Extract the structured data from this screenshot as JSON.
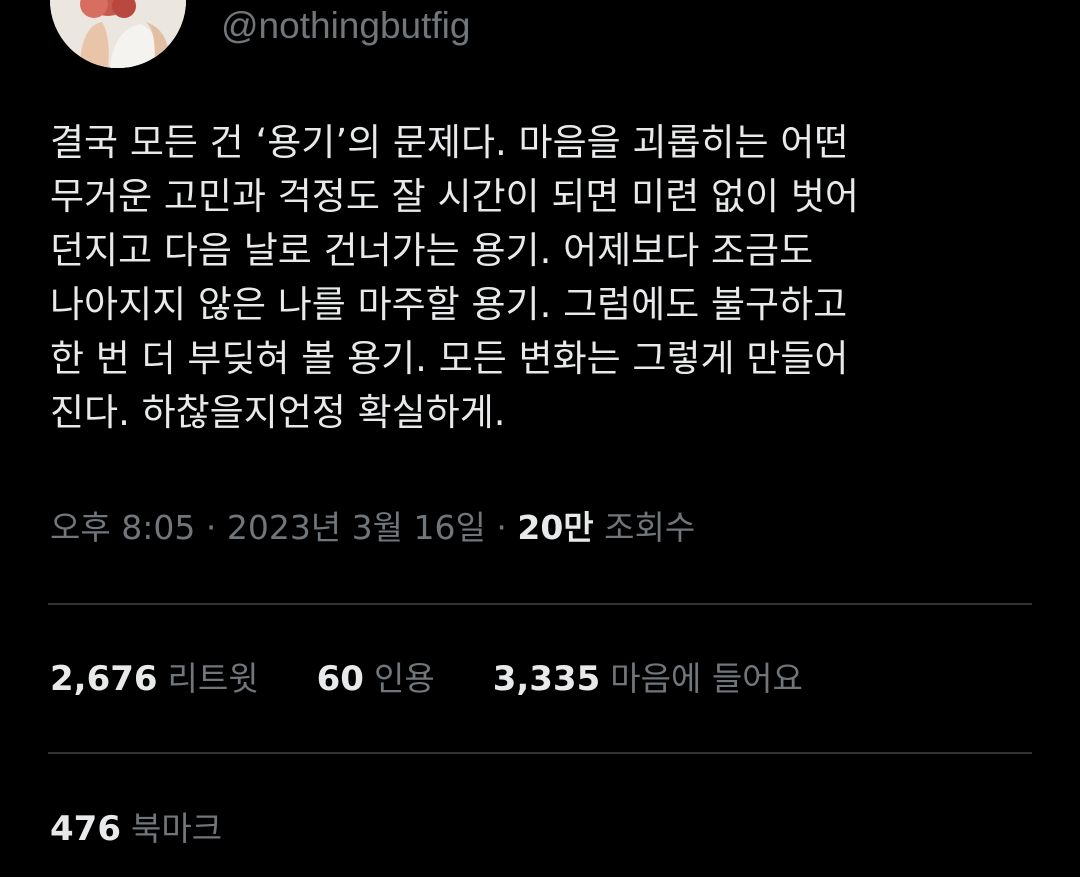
{
  "author": {
    "handle": "@nothingbutfig"
  },
  "tweet": {
    "lines": [
      "결국 모든 건 ‘용기’의 문제다. 마음을 괴롭히는 어떤",
      "무거운 고민과 걱정도 잘 시간이 되면 미련 없이 벗어",
      "던지고 다음 날로 건너가는 용기. 어제보다 조금도",
      "나아지지 않은 나를 마주할 용기. 그럼에도 불구하고",
      "한 번 더 부딪혀 볼 용기. 모든 변화는 그렇게 만들어",
      "진다. 하찮을지언정 확실하게."
    ]
  },
  "meta": {
    "time": "오후 8:05",
    "separator": "·",
    "date": "2023년 3월 16일",
    "views_count": "20만",
    "views_label": "조회수"
  },
  "stats": {
    "retweets_count": "2,676",
    "retweets_label": "리트윗",
    "quotes_count": "60",
    "quotes_label": "인용",
    "likes_count": "3,335",
    "likes_label": "마음에 들어요",
    "bookmarks_count": "476",
    "bookmarks_label": "북마크"
  },
  "colors": {
    "background": "#000000",
    "primary_text": "#e7e9ea",
    "secondary_text": "#71767b",
    "divider": "#2f3336"
  }
}
